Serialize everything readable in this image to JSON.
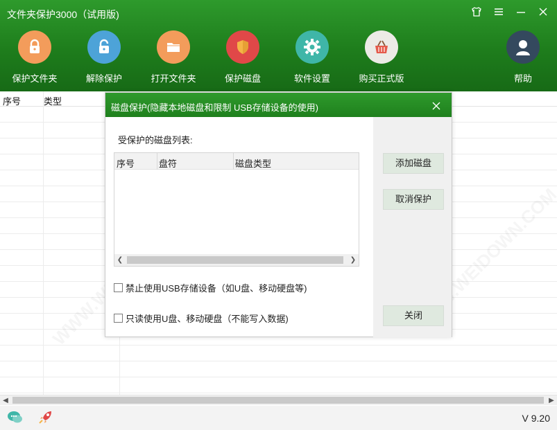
{
  "window": {
    "title": "文件夹保护3000（试用版)",
    "controls": [
      "shirt-icon",
      "menu-icon",
      "minimize-icon",
      "close-icon"
    ]
  },
  "toolbar": {
    "items": [
      {
        "label": "保护文件夹",
        "icon": "lock-icon",
        "color": "#f39c5b"
      },
      {
        "label": "解除保护",
        "icon": "unlock-icon",
        "color": "#4da3d8"
      },
      {
        "label": "打开文件夹",
        "icon": "folder-icon",
        "color": "#f39c5b"
      },
      {
        "label": "保护磁盘",
        "icon": "shield-icon",
        "color": "#e04848"
      },
      {
        "label": "软件设置",
        "icon": "gear-icon",
        "color": "#3fb6a8"
      },
      {
        "label": "购买正式版",
        "icon": "basket-icon",
        "color": "#f0a8a8"
      },
      {
        "label": "帮助",
        "icon": "user-icon",
        "color": "#34495e"
      }
    ]
  },
  "table": {
    "columns": [
      "序号",
      "类型"
    ]
  },
  "dialog": {
    "title": "磁盘保护(隐藏本地磁盘和限制 USB存储设备的使用)",
    "list_label": "受保护的磁盘列表:",
    "list_columns": [
      "序号",
      "盘符",
      "磁盘类型"
    ],
    "buttons": {
      "add": "添加磁盘",
      "cancel_protect": "取消保护",
      "close": "关闭"
    },
    "checkboxes": [
      {
        "label": "禁止使用USB存储设备（如U盘、移动硬盘等)",
        "checked": false
      },
      {
        "label": "只读使用U盘、移动硬盘（不能写入数据)",
        "checked": false
      }
    ]
  },
  "status": {
    "version": "V 9.20"
  },
  "colors": {
    "header_green": "#1e7d1c",
    "button_bg": "#dfe9df"
  }
}
